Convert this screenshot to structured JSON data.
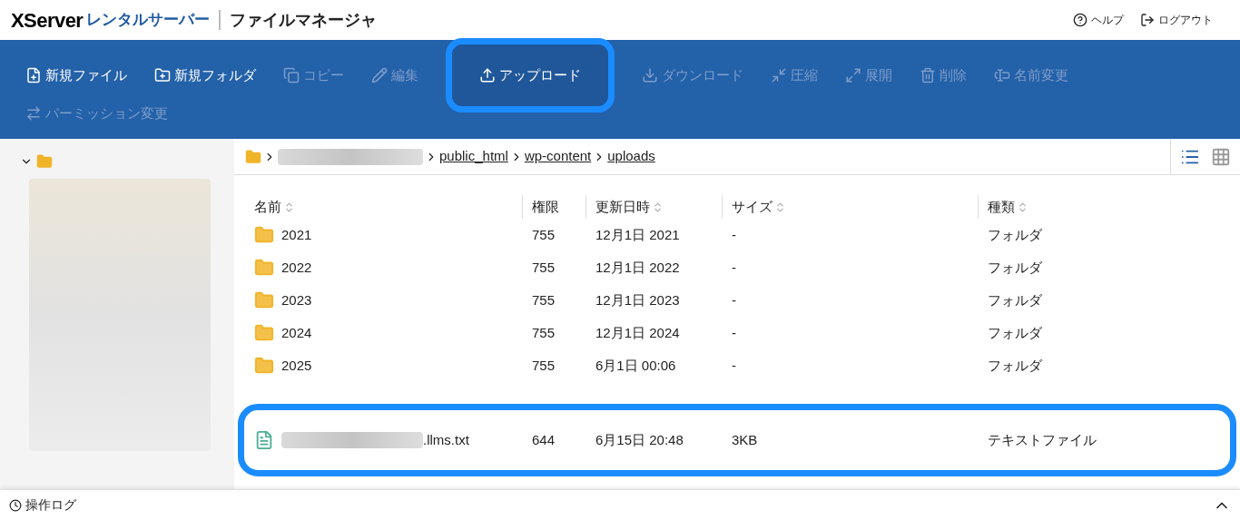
{
  "header": {
    "logo": "XServer",
    "logo_sub": "レンタルサーバー",
    "title": "ファイルマネージャ",
    "links": [
      {
        "kind": "help",
        "label": "ヘルプ"
      },
      {
        "kind": "logout",
        "label": "ログアウト"
      }
    ]
  },
  "toolbar": [
    {
      "kind": "new-file",
      "label": "新規ファイル",
      "disabled": false,
      "highlighted": false
    },
    {
      "kind": "new-folder",
      "label": "新規フォルダ",
      "disabled": false,
      "highlighted": false
    },
    {
      "kind": "copy",
      "label": "コピー",
      "disabled": true,
      "highlighted": false
    },
    {
      "kind": "edit",
      "label": "編集",
      "disabled": true,
      "highlighted": false
    },
    {
      "kind": "upload",
      "label": "アップロード",
      "disabled": false,
      "highlighted": true
    },
    {
      "kind": "download",
      "label": "ダウンロード",
      "disabled": true,
      "highlighted": false
    },
    {
      "kind": "compress",
      "label": "圧縮",
      "disabled": true,
      "highlighted": false
    },
    {
      "kind": "extract",
      "label": "展開",
      "disabled": true,
      "highlighted": false
    },
    {
      "kind": "delete",
      "label": "削除",
      "disabled": true,
      "highlighted": false
    },
    {
      "kind": "rename",
      "label": "名前変更",
      "disabled": true,
      "highlighted": false
    },
    {
      "kind": "permission",
      "label": "パーミッション変更",
      "disabled": true,
      "highlighted": false
    }
  ],
  "sidebar": {
    "root_expanded": true
  },
  "breadcrumb": [
    {
      "label": "public_html"
    },
    {
      "label": "wp-content"
    },
    {
      "label": "uploads"
    }
  ],
  "view_modes": [
    {
      "kind": "list",
      "selected": true
    },
    {
      "kind": "grid",
      "selected": false
    }
  ],
  "table": {
    "columns": [
      {
        "label": "名前",
        "sortable": true
      },
      {
        "label": "権限",
        "sortable": false
      },
      {
        "label": "更新日時",
        "sortable": true
      },
      {
        "label": "サイズ",
        "sortable": true
      },
      {
        "label": "種類",
        "sortable": true
      }
    ],
    "rows": [
      {
        "kind": "folder",
        "name": "2021",
        "permission": "755",
        "modified": "12月1日 2021",
        "size": "-",
        "type": "フォルダ",
        "highlighted": false
      },
      {
        "kind": "folder",
        "name": "2022",
        "permission": "755",
        "modified": "12月1日 2022",
        "size": "-",
        "type": "フォルダ",
        "highlighted": false
      },
      {
        "kind": "folder",
        "name": "2023",
        "permission": "755",
        "modified": "12月1日 2023",
        "size": "-",
        "type": "フォルダ",
        "highlighted": false
      },
      {
        "kind": "folder",
        "name": "2024",
        "permission": "755",
        "modified": "12月1日 2024",
        "size": "-",
        "type": "フォルダ",
        "highlighted": false
      },
      {
        "kind": "folder",
        "name": "2025",
        "permission": "755",
        "modified": "6月1日 00:06",
        "size": "-",
        "type": "フォルダ",
        "highlighted": false
      },
      {
        "kind": "text-file",
        "name": ".llms.txt",
        "name_redacted": true,
        "permission": "644",
        "modified": "6月15日 20:48",
        "size": "3KB",
        "type": "テキストファイル",
        "highlighted": true
      }
    ]
  },
  "log_bar": {
    "label": "操作ログ",
    "expanded": false
  }
}
